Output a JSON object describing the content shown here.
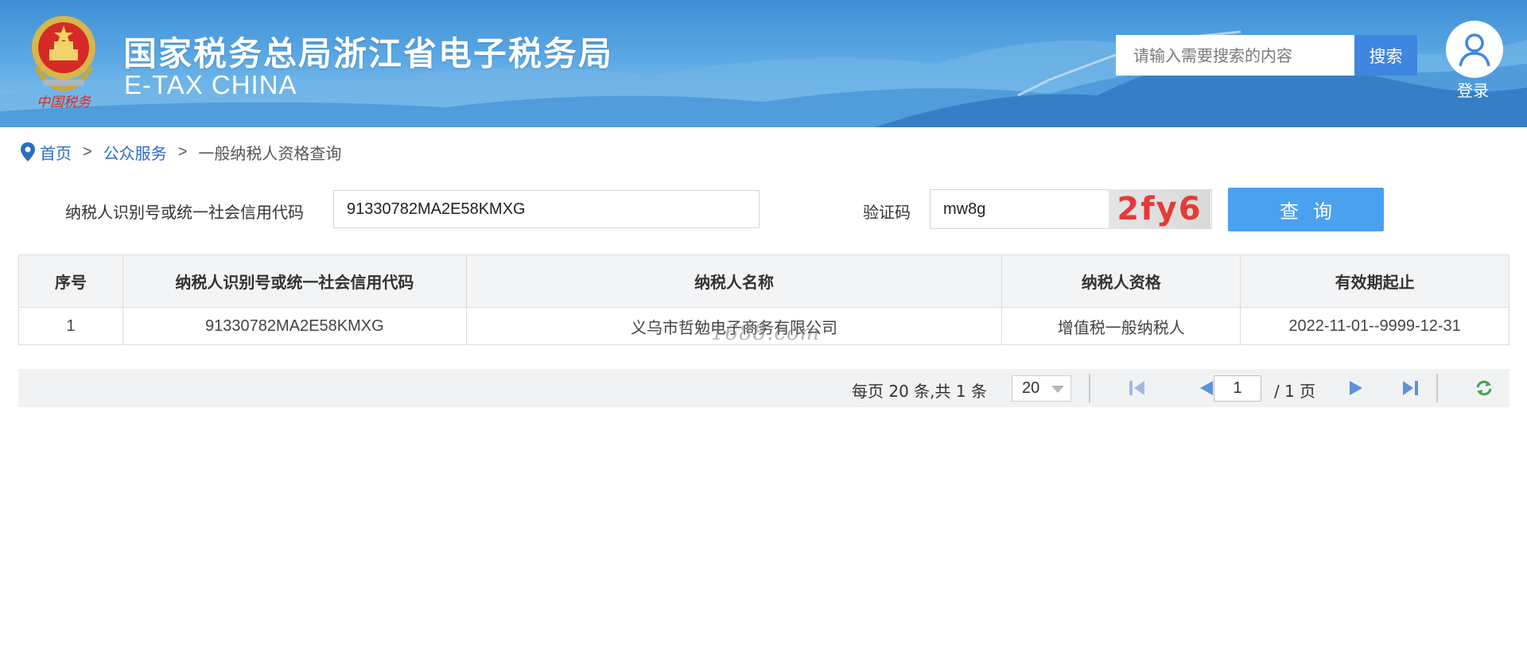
{
  "header": {
    "title": "国家税务总局浙江省电子税务局",
    "subtitle": "E-TAX CHINA",
    "search_placeholder": "请输入需要搜索的内容",
    "search_button": "搜索",
    "login_label": "登录"
  },
  "breadcrumb": {
    "items": [
      "首页",
      "公众服务",
      "一般纳税人资格查询"
    ],
    "separator": ">"
  },
  "form": {
    "taxpayer_id_label": "纳税人识别号或统一社会信用代码",
    "taxpayer_id_value": "91330782MA2E58KMXG",
    "captcha_label": "验证码",
    "captcha_value": "mw8g",
    "captcha_image_text": "2fy6",
    "query_button": "查询"
  },
  "table": {
    "headers": [
      "序号",
      "纳税人识别号或统一社会信用代码",
      "纳税人名称",
      "纳税人资格",
      "有效期起止"
    ],
    "rows": [
      [
        "1",
        "91330782MA2E58KMXG",
        "义乌市哲勉电子商务有限公司",
        "增值税一般纳税人",
        "2022-11-01--9999-12-31"
      ]
    ]
  },
  "watermark": "1688.com",
  "pagination": {
    "summary": "每页 20 条,共 1 条",
    "page_size": "20",
    "current_page": "1",
    "total_pages": "/ 1 页"
  },
  "colors": {
    "header_blue": "#3e8fd6",
    "link_blue": "#2b6cc4",
    "button_blue": "#4aa1f0",
    "captcha_red": "#e63a36"
  }
}
